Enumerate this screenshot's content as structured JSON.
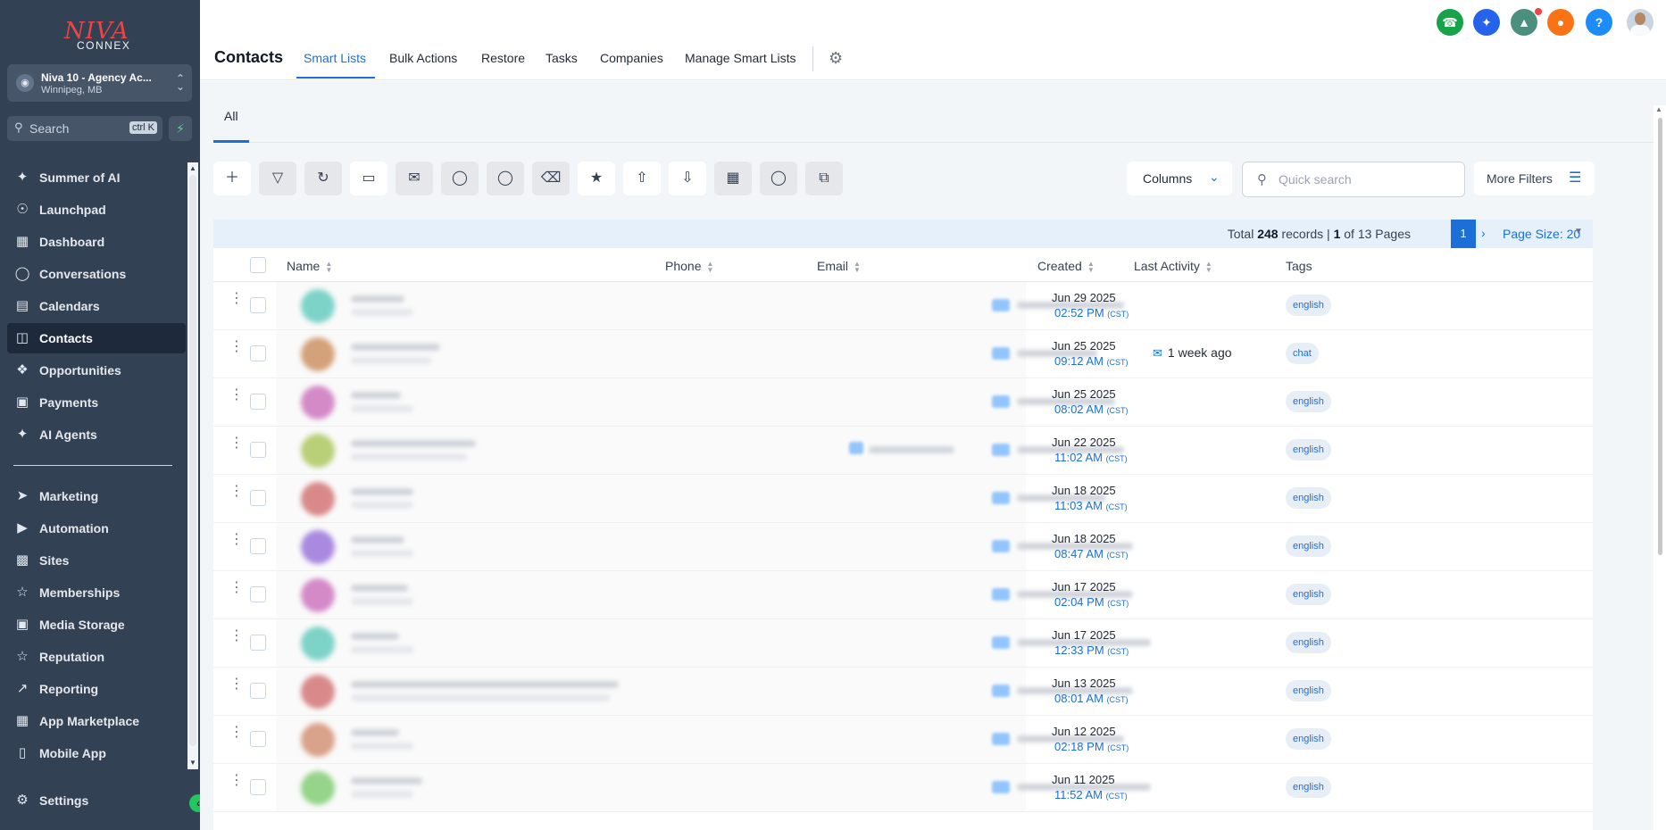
{
  "sidebar": {
    "logo_main": "NIVA",
    "logo_sub": "CONNEX",
    "account_name": "Niva 10 - Agency Ac...",
    "account_location": "Winnipeg, MB",
    "search_label": "Search",
    "search_shortcut": "ctrl K",
    "items": [
      {
        "label": "Summer of AI",
        "icon": "sparkle-icon"
      },
      {
        "label": "Launchpad",
        "icon": "rocket-icon"
      },
      {
        "label": "Dashboard",
        "icon": "grid-icon"
      },
      {
        "label": "Conversations",
        "icon": "chat-icon"
      },
      {
        "label": "Calendars",
        "icon": "calendar-icon"
      },
      {
        "label": "Contacts",
        "icon": "contacts-icon"
      },
      {
        "label": "Opportunities",
        "icon": "opportunities-icon"
      },
      {
        "label": "Payments",
        "icon": "payments-icon"
      },
      {
        "label": "AI Agents",
        "icon": "sparkle-icon"
      },
      {
        "label": "Marketing",
        "icon": "send-icon"
      },
      {
        "label": "Automation",
        "icon": "automation-icon"
      },
      {
        "label": "Sites",
        "icon": "sites-icon"
      },
      {
        "label": "Memberships",
        "icon": "memberships-icon"
      },
      {
        "label": "Media Storage",
        "icon": "image-icon"
      },
      {
        "label": "Reputation",
        "icon": "star-icon"
      },
      {
        "label": "Reporting",
        "icon": "trend-icon"
      },
      {
        "label": "App Marketplace",
        "icon": "apps-icon"
      },
      {
        "label": "Mobile App",
        "icon": "mobile-icon"
      },
      {
        "label": "Settings",
        "icon": "gear-icon"
      }
    ]
  },
  "header": {
    "title": "Contacts",
    "tabs": [
      "Smart Lists",
      "Bulk Actions",
      "Restore",
      "Tasks",
      "Companies",
      "Manage Smart Lists"
    ],
    "active_tab": "Smart Lists"
  },
  "subtabs": [
    "All"
  ],
  "toolbar": {
    "columns_label": "Columns",
    "quick_search_placeholder": "Quick search",
    "more_filters_label": "More Filters"
  },
  "pagination": {
    "total_prefix": "Total ",
    "total_records": "248",
    "records_mid": " records | ",
    "current_page": "1",
    "pages_suffix": " of 13 Pages",
    "page_button": "1",
    "page_size_label": "Page Size: 20"
  },
  "table": {
    "columns": [
      "Name",
      "Phone",
      "Email",
      "Created",
      "Last Activity",
      "Tags"
    ],
    "rows": [
      {
        "date": "Jun 29 2025",
        "time": "02:52 PM",
        "tz": "(CST)",
        "activity": "",
        "tag": "english"
      },
      {
        "date": "Jun 25 2025",
        "time": "09:12 AM",
        "tz": "(CST)",
        "activity": "1 week ago",
        "tag": "chat"
      },
      {
        "date": "Jun 25 2025",
        "time": "08:02 AM",
        "tz": "(CST)",
        "activity": "",
        "tag": "english"
      },
      {
        "date": "Jun 22 2025",
        "time": "11:02 AM",
        "tz": "(CST)",
        "activity": "",
        "tag": "english"
      },
      {
        "date": "Jun 18 2025",
        "time": "11:03 AM",
        "tz": "(CST)",
        "activity": "",
        "tag": "english"
      },
      {
        "date": "Jun 18 2025",
        "time": "08:47 AM",
        "tz": "(CST)",
        "activity": "",
        "tag": "english"
      },
      {
        "date": "Jun 17 2025",
        "time": "02:04 PM",
        "tz": "(CST)",
        "activity": "",
        "tag": "english"
      },
      {
        "date": "Jun 17 2025",
        "time": "12:33 PM",
        "tz": "(CST)",
        "activity": "",
        "tag": "english"
      },
      {
        "date": "Jun 13 2025",
        "time": "08:01 AM",
        "tz": "(CST)",
        "activity": "",
        "tag": "english"
      },
      {
        "date": "Jun 12 2025",
        "time": "02:18 PM",
        "tz": "(CST)",
        "activity": "",
        "tag": "english"
      },
      {
        "date": "Jun 11 2025",
        "time": "11:52 AM",
        "tz": "(CST)",
        "activity": "",
        "tag": "english"
      }
    ]
  },
  "colors": {
    "sidebar_bg": "#334155",
    "accent": "#1d6fd8",
    "phone_btn": "#16a34a",
    "notification_btn": "#f97316",
    "help_btn": "#1d8cf8",
    "brand_red": "#ef4444"
  }
}
